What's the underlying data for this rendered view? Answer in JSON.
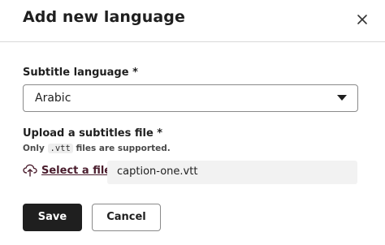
{
  "dialog": {
    "title": "Add new language",
    "close_icon": "close-icon"
  },
  "subtitle_language": {
    "label": "Subtitle language *",
    "selected": "Arabic",
    "caret_icon": "caret-down-icon"
  },
  "upload": {
    "label": "Upload a subtitles file *",
    "hint_prefix": "Only",
    "hint_code": ".vtt",
    "hint_suffix": "files are supported.",
    "icon": "cloud-upload-icon",
    "select_file_label": "Select a file",
    "file_name": "caption-one.vtt"
  },
  "actions": {
    "save_label": "Save",
    "cancel_label": "Cancel"
  },
  "colors": {
    "primary_button": "#1f1f1f",
    "link": "#4a1d2d",
    "divider": "#d9d9d9",
    "file_box": "#f2f2f2"
  }
}
